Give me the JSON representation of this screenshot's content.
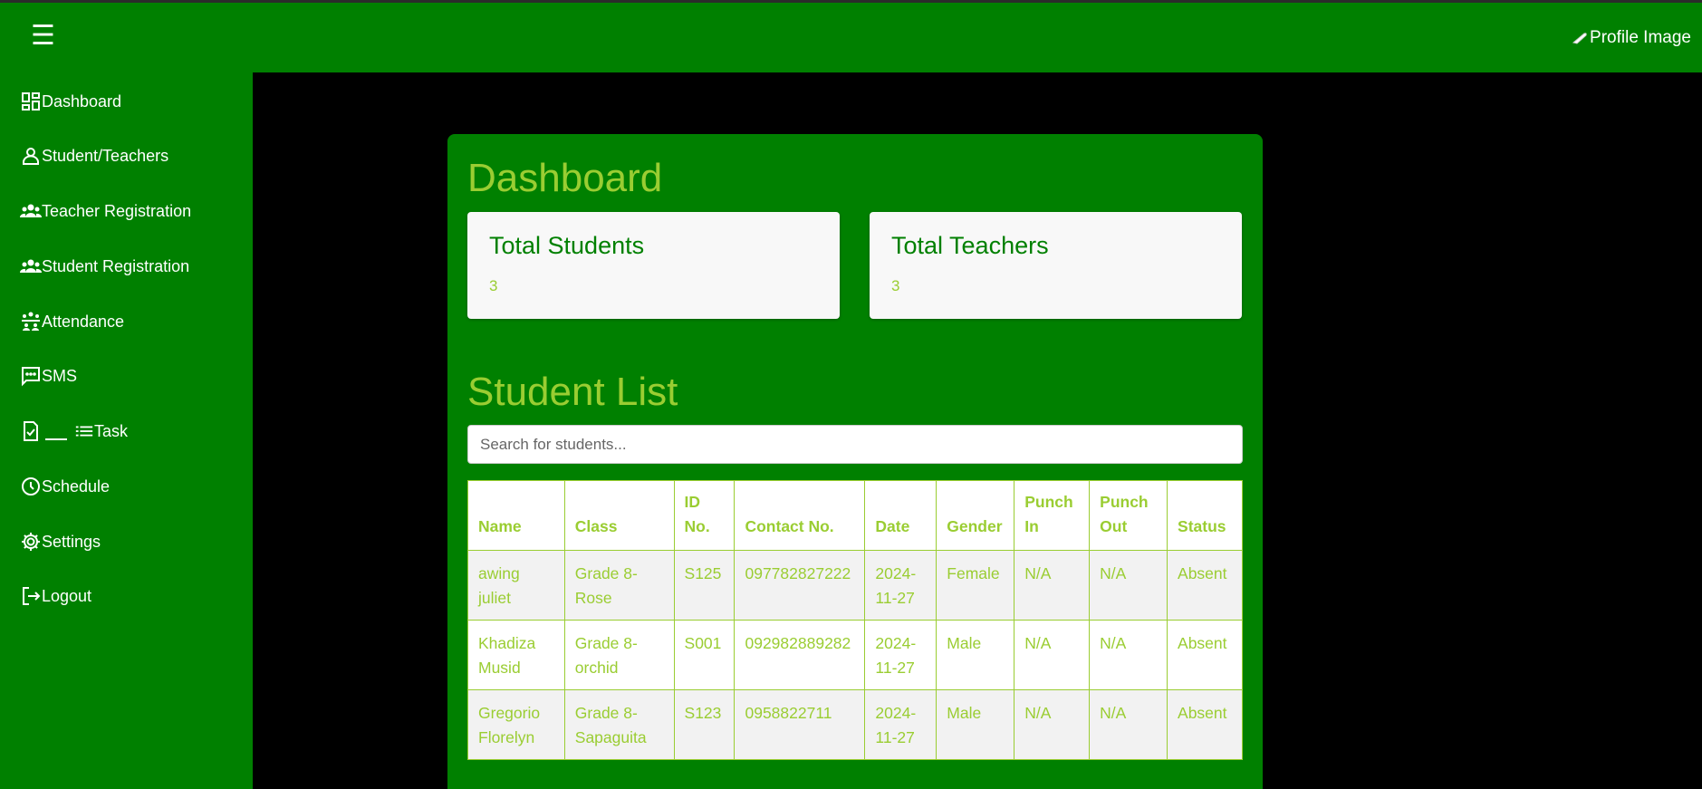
{
  "header": {
    "menu_icon": "☰",
    "profile_label": "Profile Image"
  },
  "sidebar": {
    "items": [
      {
        "label": "Dashboard",
        "icon": "dashboard-icon"
      },
      {
        "label": "Student/Teachers",
        "icon": "person-icon"
      },
      {
        "label": "Teacher Registration",
        "icon": "group-icon"
      },
      {
        "label": "Student Registration",
        "icon": "group-icon"
      },
      {
        "label": "Attendance",
        "icon": "attendance-icon"
      },
      {
        "label": "SMS",
        "icon": "message-icon"
      },
      {
        "label": "Task",
        "icon": "task-icon"
      },
      {
        "label": "Schedule",
        "icon": "clock-icon"
      },
      {
        "label": "Settings",
        "icon": "gear-icon"
      },
      {
        "label": "Logout",
        "icon": "logout-icon"
      }
    ]
  },
  "dashboard": {
    "title": "Dashboard",
    "stats": [
      {
        "label": "Total Students",
        "value": "3"
      },
      {
        "label": "Total Teachers",
        "value": "3"
      }
    ]
  },
  "student_list": {
    "title": "Student List",
    "search_placeholder": "Search for students...",
    "columns": [
      "Name",
      "Class",
      "ID No.",
      "Contact No.",
      "Date",
      "Gender",
      "Punch In",
      "Punch Out",
      "Status"
    ],
    "rows": [
      [
        "awing juliet",
        "Grade 8-Rose",
        "S125",
        "097782827222",
        "2024-11-27",
        "Female",
        "N/A",
        "N/A",
        "Absent"
      ],
      [
        "Khadiza Musid",
        "Grade 8-orchid",
        "S001",
        "092982889282",
        "2024-11-27",
        "Male",
        "N/A",
        "N/A",
        "Absent"
      ],
      [
        "Gregorio Florelyn",
        "Grade 8-Sapaguita",
        "S123",
        "0958822711",
        "2024-11-27",
        "Male",
        "N/A",
        "N/A",
        "Absent"
      ]
    ]
  },
  "colors": {
    "primary_green": "#008000",
    "accent_yellowgreen": "#9acd32",
    "background": "#000000"
  }
}
